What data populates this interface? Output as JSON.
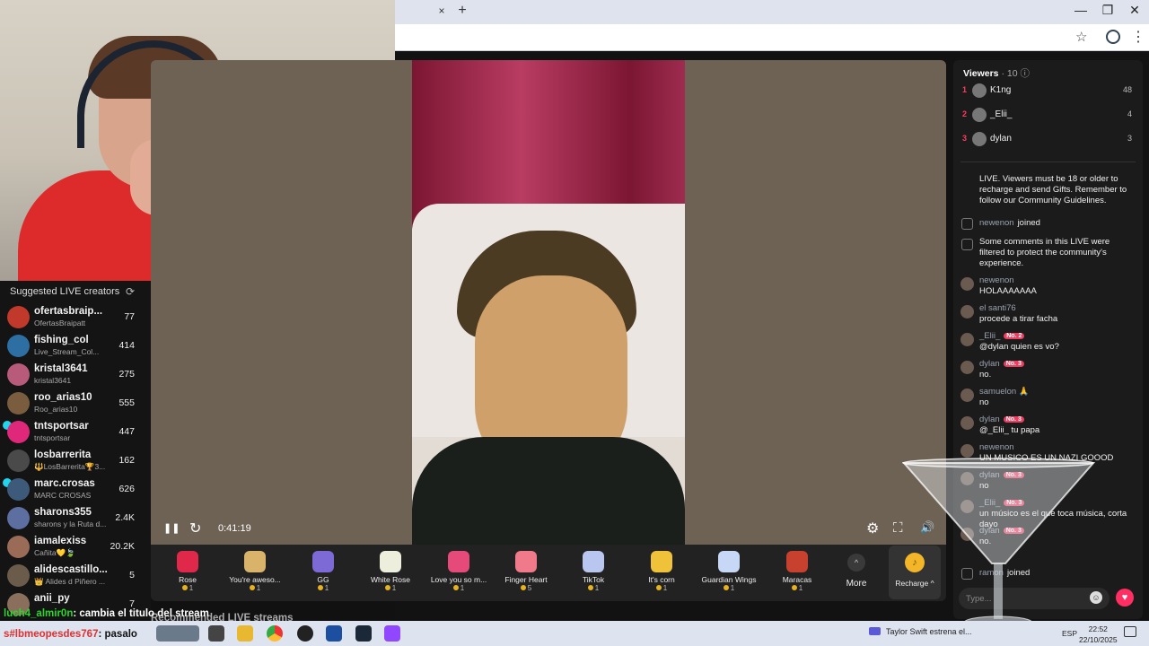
{
  "browser": {
    "tab_close": "×",
    "new_tab": "+",
    "window_controls": [
      "—",
      "❐",
      "✕"
    ],
    "star_icon": "☆",
    "menu_icon": "⋮"
  },
  "suggested": {
    "title": "Suggested LIVE creators",
    "refresh_icon": "⟳",
    "items": [
      {
        "name": "ofertasbraip...",
        "sub": "OfertasBraipatt",
        "count": "77",
        "color": "#c0392b"
      },
      {
        "name": "fishing_col",
        "sub": "Live_Stream_Col...",
        "count": "414",
        "color": "#2e6fa3"
      },
      {
        "name": "kristal3641",
        "sub": "kristal3641",
        "count": "275",
        "color": "#b85a7a"
      },
      {
        "name": "roo_arias10",
        "sub": "Roo_arias10",
        "count": "555",
        "color": "#7a5c3e"
      },
      {
        "name": "tntsportsar",
        "sub": "tntsportsar",
        "count": "447",
        "color": "#e0287a",
        "verified": true
      },
      {
        "name": "losbarrerita",
        "sub": "🔱LosBarrerita🏆3...",
        "count": "162",
        "color": "#4a4a4a"
      },
      {
        "name": "marc.crosas",
        "sub": "MARC CROSAS",
        "count": "626",
        "color": "#3d5a7a",
        "verified": true
      },
      {
        "name": "sharons355",
        "sub": "sharons y la Ruta d...",
        "count": "2.4K",
        "color": "#5d6fa0"
      },
      {
        "name": "iamalexiss",
        "sub": "Cañita💛🍃",
        "count": "20.2K",
        "color": "#9a6b57"
      },
      {
        "name": "alidescastillo...",
        "sub": "👑 Alides d Piñero ...",
        "count": "5",
        "color": "#6b5b4b"
      },
      {
        "name": "anii_py",
        "sub": "",
        "count": "7",
        "color": "#8a6f5c"
      }
    ]
  },
  "player": {
    "pause_icon": "❚❚",
    "replay_icon": "↻",
    "elapsed": "0:41:19",
    "settings_icon": "⚙",
    "fullscreen_icon": "⛶",
    "volume_icon": "🔊"
  },
  "gifts": [
    {
      "name": "Rose",
      "price": "1",
      "color": "#e0284a"
    },
    {
      "name": "You're aweso...",
      "price": "1",
      "color": "#d9b36a"
    },
    {
      "name": "GG",
      "price": "1",
      "color": "#7d6ad6"
    },
    {
      "name": "White Rose",
      "price": "1",
      "color": "#eeeedd"
    },
    {
      "name": "Love you so m...",
      "price": "1",
      "color": "#e64a7a"
    },
    {
      "name": "Finger Heart",
      "price": "5",
      "color": "#f07a8a"
    },
    {
      "name": "TikTok",
      "price": "1",
      "color": "#b9c6f0"
    },
    {
      "name": "It's corn",
      "price": "1",
      "color": "#f0c23a"
    },
    {
      "name": "Guardian Wings",
      "price": "1",
      "color": "#c6d8f6"
    },
    {
      "name": "Maracas",
      "price": "1",
      "color": "#c8402e"
    }
  ],
  "gift_more": {
    "label": "More",
    "icon": "^"
  },
  "recharge": {
    "label": "Recharge ^",
    "coin": "♪"
  },
  "recommended_label": "Recommended LIVE streams",
  "viewers": {
    "title": "Viewers",
    "count": "· 10",
    "info_icon": "ⓘ",
    "top": [
      {
        "rank": "1",
        "name": "K1ng",
        "score": "48"
      },
      {
        "rank": "2",
        "name": "_Elii_",
        "score": "4"
      },
      {
        "rank": "3",
        "name": "dylan",
        "score": "3"
      }
    ]
  },
  "chat": {
    "messages": [
      {
        "type": "system-partial",
        "text": "LIVE. Viewers must be 18 or older to recharge and send Gifts. Remember to follow our Community Guidelines."
      },
      {
        "type": "join",
        "user": "newenon",
        "text": "joined"
      },
      {
        "type": "system",
        "text": "Some comments in this LIVE were filtered to protect the community's experience."
      },
      {
        "type": "msg",
        "user": "newenon",
        "text": "HOLAAAAAAA"
      },
      {
        "type": "msg",
        "user": "el santi76",
        "text": "procede a tirar facha"
      },
      {
        "type": "msg",
        "user": "_Elii_",
        "badge": "No. 2",
        "text": "@dylan quien es vo?"
      },
      {
        "type": "msg",
        "user": "dylan",
        "badge": "No. 3",
        "text": "no."
      },
      {
        "type": "msg",
        "user": "samuelon 🙏",
        "text": "no"
      },
      {
        "type": "msg",
        "user": "dylan",
        "badge": "No. 3",
        "text": "@_Elii_ tu papa"
      },
      {
        "type": "msg",
        "user": "newenon",
        "text": "UN MUSICO ES UN NAZI GOOOD"
      },
      {
        "type": "msg",
        "user": "dylan",
        "badge": "No. 3",
        "text": "no"
      },
      {
        "type": "msg",
        "user": "_Elii_",
        "badge": "No. 3",
        "text": "un músico es el que toca música, corta dayo"
      },
      {
        "type": "msg",
        "user": "dylan",
        "badge": "No. 3",
        "text": "no."
      },
      {
        "type": "join",
        "user": "ramon",
        "text": "joined"
      }
    ],
    "input_placeholder": "Type...",
    "emoji_icon": "☺",
    "heart_icon": "♥"
  },
  "stream_overlay": {
    "line1_user": "luch4_almir0n",
    "line1_text": ": cambia el titulo del stream",
    "line2_user": "s#lbmeopesdes767",
    "line2_text": ": pasalo"
  },
  "taskbar": {
    "notification": "Taylor Swift estrena el...",
    "language": "ESP",
    "time": "22:52",
    "date": "22/10/2025"
  }
}
